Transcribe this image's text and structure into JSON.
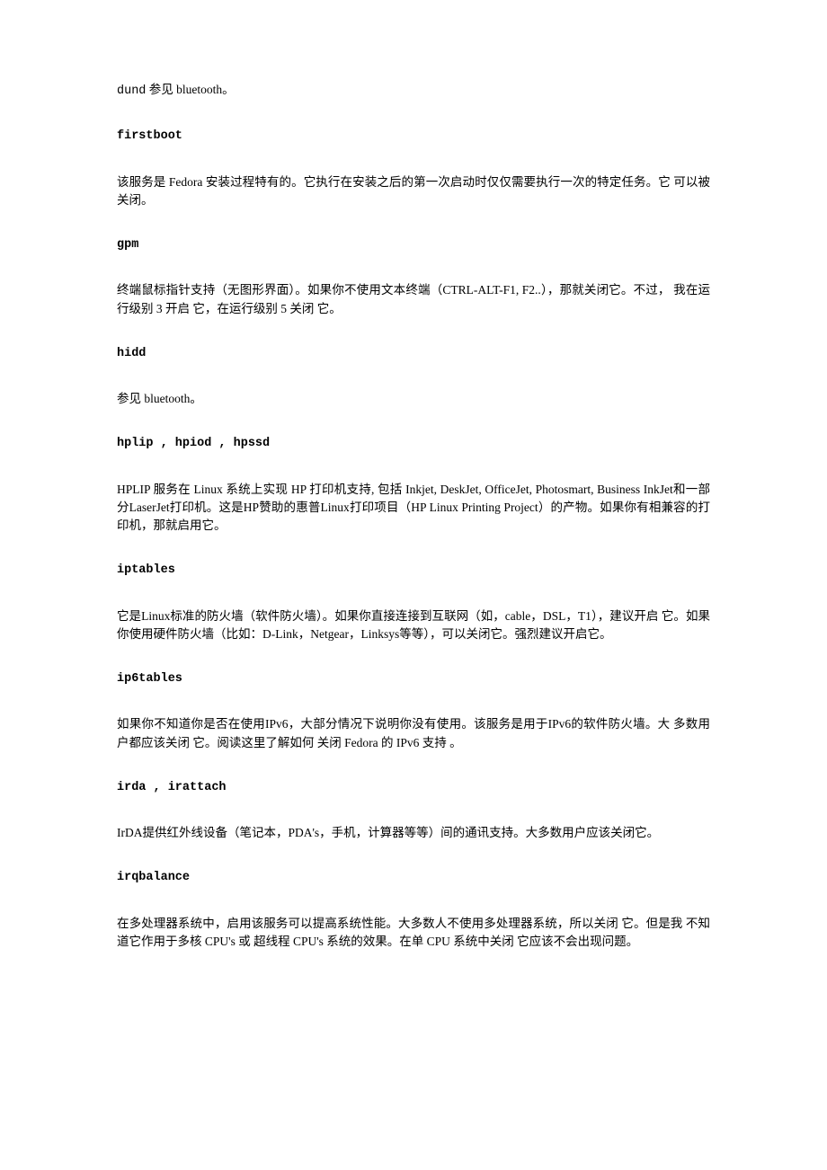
{
  "sections": [
    {
      "heading": "dund",
      "heading_extra": " 参见 bluetooth。",
      "body": ""
    },
    {
      "heading": "firstboot",
      "body": "该服务是 Fedora 安装过程特有的。它执行在安装之后的第一次启动时仅仅需要执行一次的特定任务。它 可以被关闭。"
    },
    {
      "heading": "gpm",
      "body": "终端鼠标指针支持（无图形界面）。如果你不使用文本终端（CTRL-ALT-F1, F2..），那就关闭它。不过， 我在运行级别 3 开启 它，在运行级别 5 关闭 它。"
    },
    {
      "heading": "hidd",
      "body": "参见 bluetooth。"
    },
    {
      "heading": "hplip , hpiod , hpssd",
      "body": "HPLIP 服务在 Linux 系统上实现 HP 打印机支持, 包括 Inkjet,  DeskJet,  OfficeJet,  Photosmart, Business InkJet和一部分LaserJet打印机。这是HP赞助的惠普Linux打印项目（HP Linux Printing Project）的产物。如果你有相兼容的打印机，那就启用它。"
    },
    {
      "heading": "iptables",
      "body": "它是Linux标准的防火墙（软件防火墙）。如果你直接连接到互联网（如，cable，DSL，T1），建议开启 它。如果你使用硬件防火墙（比如：D-Link，Netgear，Linksys等等），可以关闭它。强烈建议开启它。"
    },
    {
      "heading": "ip6tables",
      "body": "如果你不知道你是否在使用IPv6，大部分情况下说明你没有使用。该服务是用于IPv6的软件防火墙。大 多数用户都应该关闭 它。阅读这里了解如何 关闭 Fedora 的 IPv6 支持 。"
    },
    {
      "heading": "irda , irattach",
      "body": "IrDA提供红外线设备（笔记本，PDA's，手机，计算器等等）间的通讯支持。大多数用户应该关闭它。"
    },
    {
      "heading": "irqbalance",
      "body": "在多处理器系统中，启用该服务可以提高系统性能。大多数人不使用多处理器系统，所以关闭 它。但是我 不知道它作用于多核 CPU's 或 超线程 CPU's 系统的效果。在单 CPU 系统中关闭 它应该不会出现问题。"
    }
  ]
}
